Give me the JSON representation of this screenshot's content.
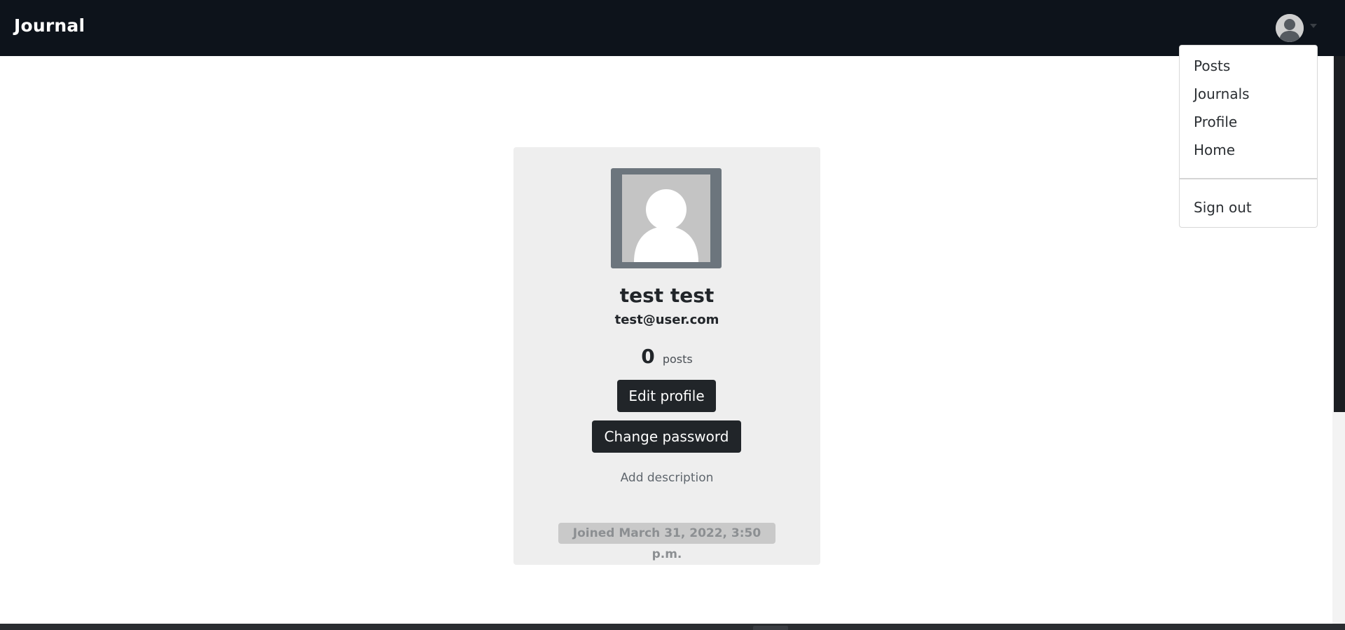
{
  "navbar": {
    "brand": "Journal"
  },
  "user_menu": {
    "avatar_icon": "user-avatar-icon",
    "caret_icon": "chevron-down-icon",
    "items": [
      {
        "label": "Posts"
      },
      {
        "label": "Journals"
      },
      {
        "label": "Profile"
      },
      {
        "label": "Home"
      }
    ],
    "sign_out": "Sign out"
  },
  "profile": {
    "photo_icon": "default-user-icon",
    "name": "test test",
    "email": "test@user.com",
    "posts_count": "0",
    "posts_label": "posts",
    "edit_button": "Edit profile",
    "change_password_button": "Change password",
    "add_description": "Add description",
    "joined": "Joined March 31, 2022, 3:50 p.m."
  },
  "colors": {
    "navbar_bg": "#0d131b",
    "button_bg": "#212529",
    "card_bg": "#eeeeee",
    "frame": "#6c757d"
  }
}
